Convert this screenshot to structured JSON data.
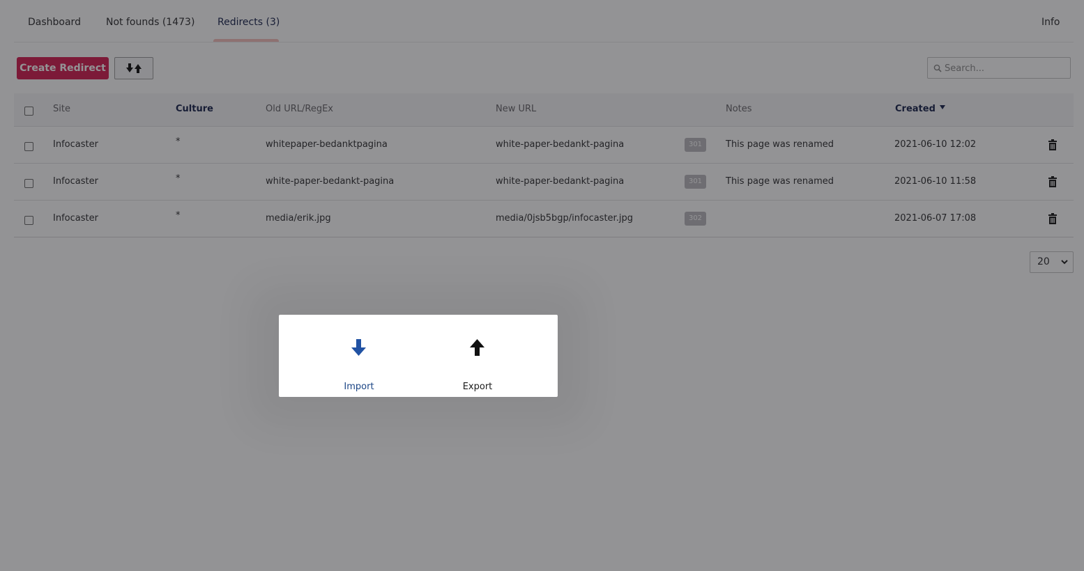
{
  "tabs": [
    {
      "label": "Dashboard"
    },
    {
      "label": "Not founds (1473)"
    },
    {
      "label": "Redirects (3)"
    }
  ],
  "info_tab": "Info",
  "toolbar": {
    "create_label": "Create Redirect",
    "import_export_icon": "arrows-down-up-icon",
    "search_placeholder": "Search..."
  },
  "table": {
    "headers": {
      "site": "Site",
      "culture": "Culture",
      "old_url": "Old URL/RegEx",
      "new_url": "New URL",
      "notes": "Notes",
      "created": "Created"
    },
    "rows": [
      {
        "site": "Infocaster",
        "culture": "*",
        "old_url": "whitepaper-bedanktpagina",
        "new_url": "white-paper-bedankt-pagina",
        "status": "301",
        "notes": "This page was renamed",
        "created": "2021-06-10 12:02"
      },
      {
        "site": "Infocaster",
        "culture": "*",
        "old_url": "white-paper-bedankt-pagina",
        "new_url": "white-paper-bedankt-pagina",
        "status": "301",
        "notes": "This page was renamed",
        "created": "2021-06-10 11:58"
      },
      {
        "site": "Infocaster",
        "culture": "*",
        "old_url": "media/erik.jpg",
        "new_url": "media/0jsb5bgp/infocaster.jpg",
        "status": "302",
        "notes": "",
        "created": "2021-06-07 17:08"
      }
    ]
  },
  "pagination": {
    "page_size": "20"
  },
  "dialog": {
    "import_label": "Import",
    "export_label": "Export"
  },
  "colors": {
    "primary": "#d42054",
    "link": "#1b264f",
    "import_arrow": "#2152a3",
    "tab_underline": "#f5c1bc"
  }
}
